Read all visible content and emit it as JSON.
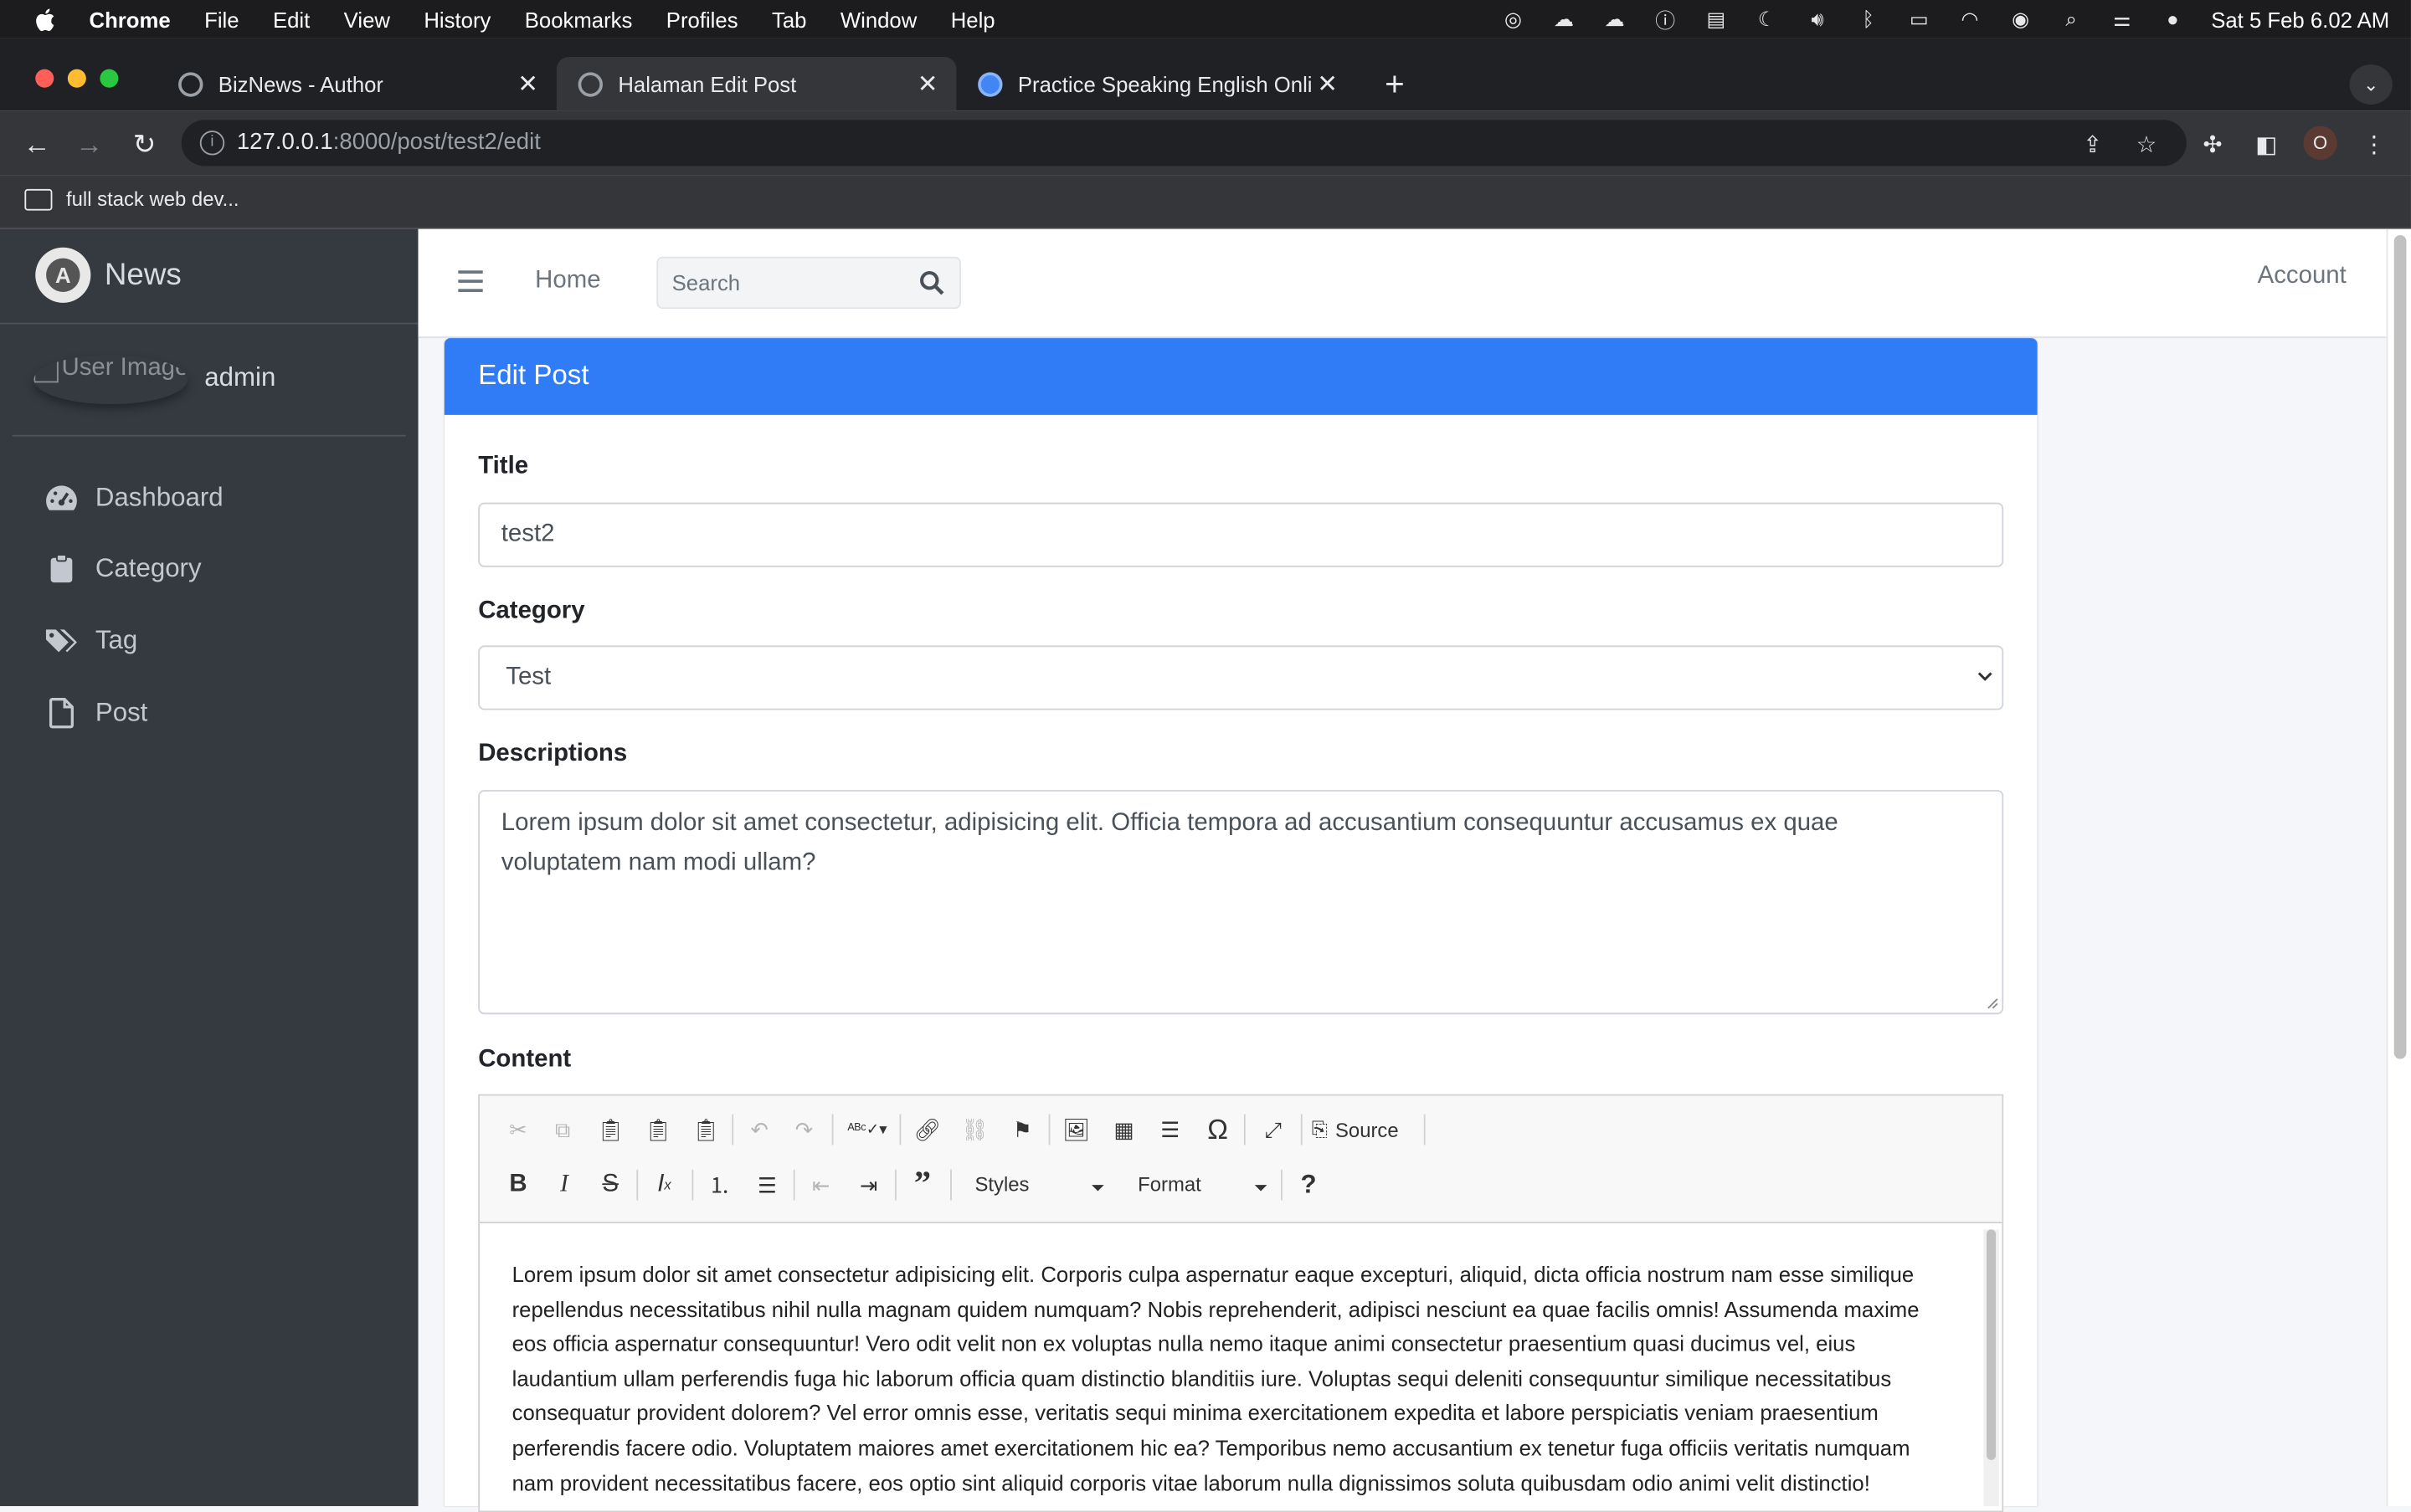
{
  "menubar": {
    "app": "Chrome",
    "items": [
      "File",
      "Edit",
      "View",
      "History",
      "Bookmarks",
      "Profiles",
      "Tab",
      "Window",
      "Help"
    ],
    "clock": "Sat 5 Feb  6.02 AM"
  },
  "tabs": [
    {
      "title": "BizNews - Author",
      "active": false
    },
    {
      "title": "Halaman Edit Post",
      "active": true
    },
    {
      "title": "Practice Speaking English Onli",
      "active": false
    }
  ],
  "address": {
    "host": "127.0.0.1",
    "rest": ":8000/post/test2/edit"
  },
  "profile_initial": "O",
  "bookmarks": [
    {
      "label": "full stack web dev..."
    }
  ],
  "sidebar": {
    "brand": "News",
    "user_image_alt": "User Image",
    "user_name": "admin",
    "items": [
      {
        "label": "Dashboard",
        "icon": "tachometer-icon"
      },
      {
        "label": "Category",
        "icon": "clipboard-icon"
      },
      {
        "label": "Tag",
        "icon": "tags-icon"
      },
      {
        "label": "Post",
        "icon": "file-icon"
      }
    ]
  },
  "header": {
    "home": "Home",
    "search_placeholder": "Search",
    "account": "Account"
  },
  "card": {
    "title": "Edit Post"
  },
  "form": {
    "title_label": "Title",
    "title_value": "test2",
    "category_label": "Category",
    "category_value": "Test",
    "descriptions_label": "Descriptions",
    "descriptions_value": "Lorem ipsum dolor sit amet consectetur, adipisicing elit. Officia tempora ad accusantium consequuntur accusamus ex quae voluptatem nam modi ullam?",
    "content_label": "Content"
  },
  "editor": {
    "source_label": "Source",
    "styles_label": "Styles",
    "format_label": "Format",
    "body": "Lorem ipsum dolor sit amet consectetur adipisicing elit. Corporis culpa aspernatur eaque excepturi, aliquid, dicta officia nostrum nam esse similique repellendus necessitatibus nihil nulla magnam quidem numquam? Nobis reprehenderit, adipisci nesciunt ea quae facilis omnis! Assumenda maxime eos officia aspernatur consequuntur! Vero odit velit non ex voluptas nulla nemo itaque animi consectetur praesentium quasi ducimus vel, eius laudantium ullam perferendis fuga hic laborum officia quam distinctio blanditiis iure. Voluptas sequi deleniti consequuntur similique necessitatibus consequatur provident dolorem? Vel error omnis esse, veritatis sequi minima exercitationem expedita et labore perspiciatis veniam praesentium perferendis facere odio. Voluptatem maiores amet exercitationem hic ea? Temporibus nemo accusantium ex tenetur fuga officiis veritatis numquam nam provident necessitatibus facere, eos optio sint aliquid corporis vitae laborum nulla dignissimos soluta quibusdam odio animi velit distinctio!"
  },
  "colors": {
    "card_header": "#2f7cf6",
    "sidebar": "#343a40"
  }
}
